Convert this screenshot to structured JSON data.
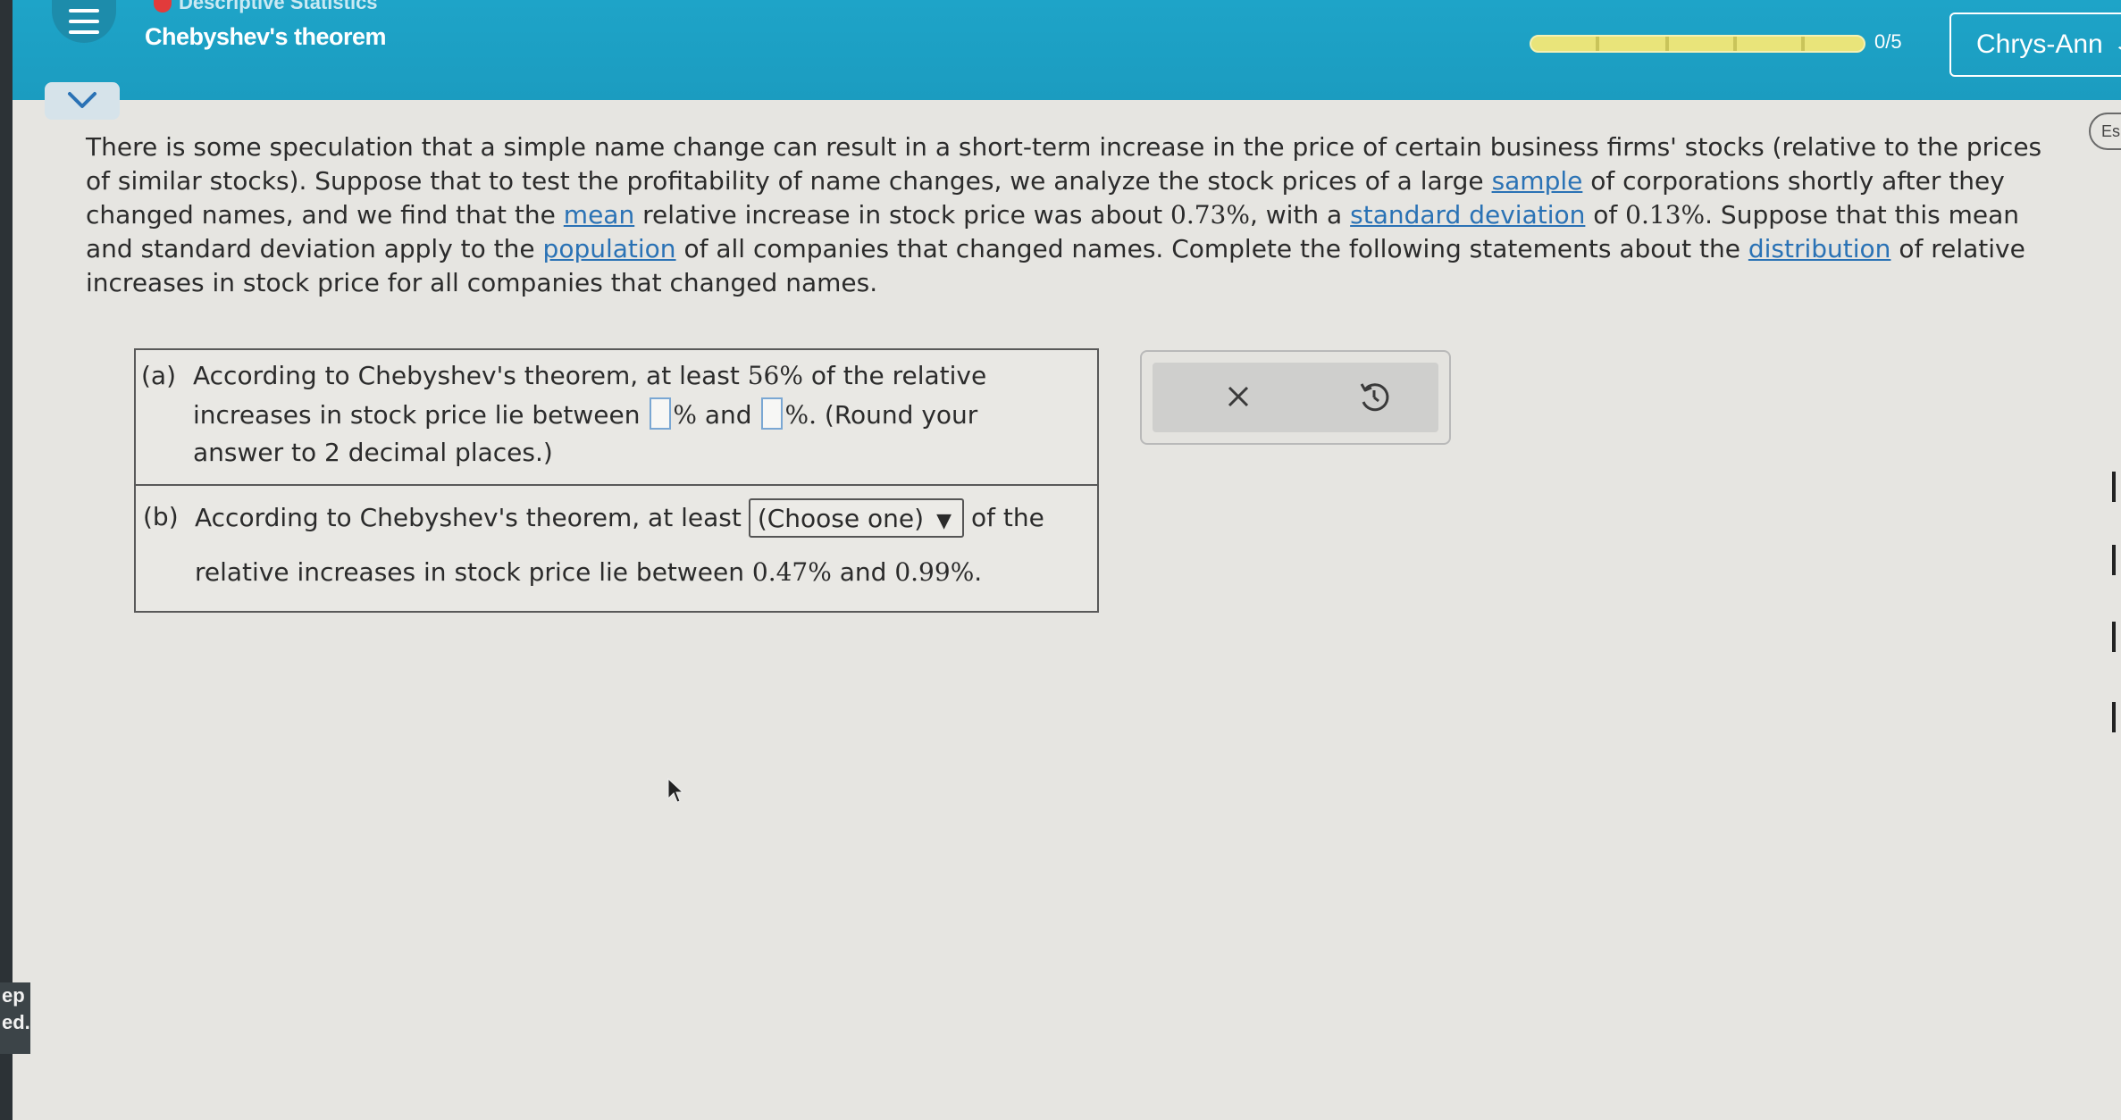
{
  "header": {
    "category": "Descriptive Statistics",
    "topic": "Chebyshev's theorem",
    "progress_label": "0/5",
    "progress_value": 0,
    "user_name": "Chrys-Ann",
    "brand_color": "#1ea4c8"
  },
  "side_buttons": {
    "language": "Es"
  },
  "left_tab": {
    "line1": "ep",
    "line2": "ed."
  },
  "problem": {
    "p1": "There is some speculation that a simple name change can result in a short-term increase in the price of certain business firms' stocks (relative to the prices of similar stocks). Suppose that to test the profitability of name changes, we analyze the stock prices of a large ",
    "link_sample": "sample",
    "p2": " of corporations shortly after they changed names, and we find that the ",
    "link_mean": "mean",
    "p3": " relative increase in stock price was about ",
    "mean_value": "0.73%",
    "p4": ", with a ",
    "link_sd": "standard deviation",
    "p5": " of ",
    "sd_value": "0.13%",
    "p6": ". Suppose that this mean and standard deviation apply to the ",
    "link_population": "population",
    "p7": " of all companies that changed names. Complete the following statements about the ",
    "link_distribution": "distribution",
    "p8": " of relative increases in stock price for all companies that changed names."
  },
  "part_a": {
    "label": "(a)",
    "t1": "According to Chebyshev's theorem, at least ",
    "pct": "56%",
    "t2": " of the relative",
    "t3": "increases in stock price lie between ",
    "pct_sign1": "%",
    "and": " and ",
    "pct_sign2": "%.",
    "t4": " (Round your",
    "t5": "answer to 2 decimal places.)",
    "input1_value": "",
    "input2_value": ""
  },
  "part_b": {
    "label": "(b)",
    "t1": "According to Chebyshev's theorem, at least",
    "select_value": "(Choose one)",
    "t2": "of the",
    "t3": "relative increases in stock price lie between ",
    "low": "0.47%",
    "and": " and ",
    "high": "0.99%",
    "end": "."
  },
  "tools": {
    "clear_icon": "close-icon",
    "undo_icon": "undo-icon"
  }
}
